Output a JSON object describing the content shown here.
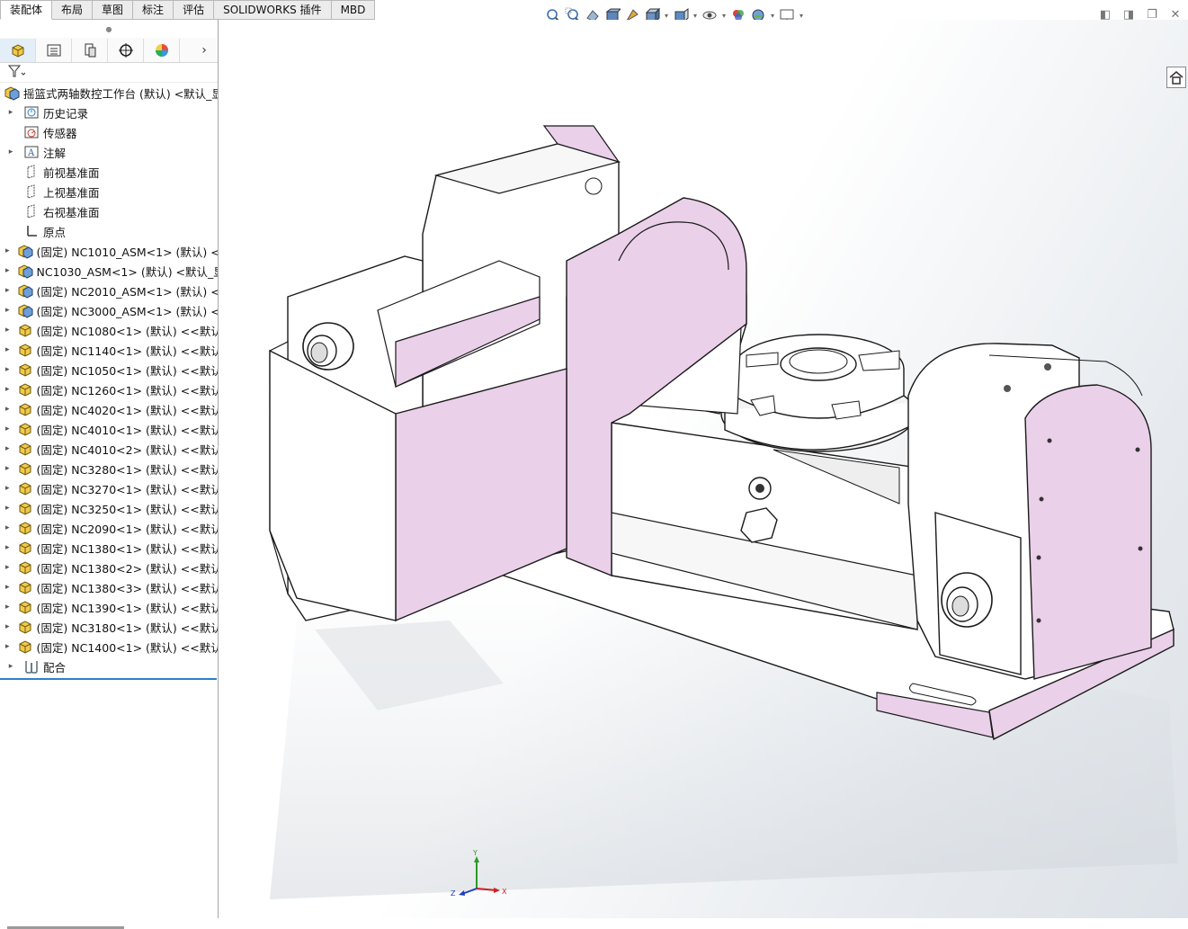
{
  "tabs": [
    {
      "label": "装配体",
      "active": true
    },
    {
      "label": "布局"
    },
    {
      "label": "草图"
    },
    {
      "label": "标注"
    },
    {
      "label": "评估"
    },
    {
      "label": "SOLIDWORKS 插件"
    },
    {
      "label": "MBD"
    }
  ],
  "toolbar_icons": [
    "zoom-to-fit-icon",
    "zoom-area-icon",
    "previous-view-icon",
    "section-view-icon",
    "dynamic-annotation-icon",
    "view-orientation-icon",
    "display-style-icon",
    "hide-show-icon",
    "edit-appearance-icon",
    "apply-scene-icon",
    "view-settings-icon"
  ],
  "window_controls": [
    "restore-pane-icon",
    "next-pane-icon",
    "restore-icon",
    "close-icon"
  ],
  "panel_tabs": [
    "featuremanager-tab",
    "propertymanager-tab",
    "configurationmanager-tab",
    "dimxpert-tab",
    "displaymanager-tab"
  ],
  "tree": {
    "root": "摇篮式两轴数控工作台 (默认) <默认_显示",
    "items": [
      {
        "label": "历史记录",
        "icon": "history-icon",
        "expandable": true
      },
      {
        "label": "传感器",
        "icon": "sensor-icon",
        "expandable": false
      },
      {
        "label": "注解",
        "icon": "annotation-icon",
        "expandable": true
      },
      {
        "label": "前视基准面",
        "icon": "plane-icon",
        "expandable": false
      },
      {
        "label": "上视基准面",
        "icon": "plane-icon",
        "expandable": false
      },
      {
        "label": "右视基准面",
        "icon": "plane-icon",
        "expandable": false
      },
      {
        "label": "原点",
        "icon": "origin-icon",
        "expandable": false
      },
      {
        "label": "(固定) NC1010_ASM<1> (默认) <默",
        "icon": "subassembly-icon",
        "expandable": true
      },
      {
        "label": "NC1030_ASM<1> (默认) <默认_显",
        "icon": "subassembly-icon",
        "expandable": true
      },
      {
        "label": "(固定) NC2010_ASM<1> (默认) <默",
        "icon": "subassembly-icon",
        "expandable": true
      },
      {
        "label": "(固定) NC3000_ASM<1> (默认) <默",
        "icon": "subassembly-icon",
        "expandable": true
      },
      {
        "label": "(固定) NC1080<1> (默认) <<默认",
        "icon": "part-icon",
        "expandable": true
      },
      {
        "label": "(固定) NC1140<1> (默认) <<默认",
        "icon": "part-icon",
        "expandable": true
      },
      {
        "label": "(固定) NC1050<1> (默认) <<默认",
        "icon": "part-icon",
        "expandable": true
      },
      {
        "label": "(固定) NC1260<1> (默认) <<默认",
        "icon": "part-icon",
        "expandable": true
      },
      {
        "label": "(固定) NC4020<1> (默认) <<默认",
        "icon": "part-icon",
        "expandable": true
      },
      {
        "label": "(固定) NC4010<1> (默认) <<默认",
        "icon": "part-icon",
        "expandable": true
      },
      {
        "label": "(固定) NC4010<2> (默认) <<默认",
        "icon": "part-icon",
        "expandable": true
      },
      {
        "label": "(固定) NC3280<1> (默认) <<默认",
        "icon": "part-icon",
        "expandable": true
      },
      {
        "label": "(固定) NC3270<1> (默认) <<默认",
        "icon": "part-icon",
        "expandable": true
      },
      {
        "label": "(固定) NC3250<1> (默认) <<默认",
        "icon": "part-icon",
        "expandable": true
      },
      {
        "label": "(固定) NC2090<1> (默认) <<默认",
        "icon": "part-icon",
        "expandable": true
      },
      {
        "label": "(固定) NC1380<1> (默认) <<默认",
        "icon": "part-icon",
        "expandable": true
      },
      {
        "label": "(固定) NC1380<2> (默认) <<默认",
        "icon": "part-icon",
        "expandable": true
      },
      {
        "label": "(固定) NC1380<3> (默认) <<默认",
        "icon": "part-icon",
        "expandable": true
      },
      {
        "label": "(固定) NC1390<1> (默认) <<默认",
        "icon": "part-icon",
        "expandable": true
      },
      {
        "label": "(固定) NC3180<1> (默认) <<默认",
        "icon": "part-icon",
        "expandable": true
      },
      {
        "label": "(固定) NC1400<1> (默认) <<默认",
        "icon": "part-icon",
        "expandable": true
      },
      {
        "label": "配合",
        "icon": "mates-icon",
        "expandable": true
      }
    ]
  },
  "triad": {
    "x": "X",
    "y": "Y",
    "z": "Z"
  },
  "colors": {
    "accent": "#2e7fc6",
    "model_face": "#ebd0ea",
    "model_white": "#ffffff",
    "edge": "#1a1a1a"
  }
}
